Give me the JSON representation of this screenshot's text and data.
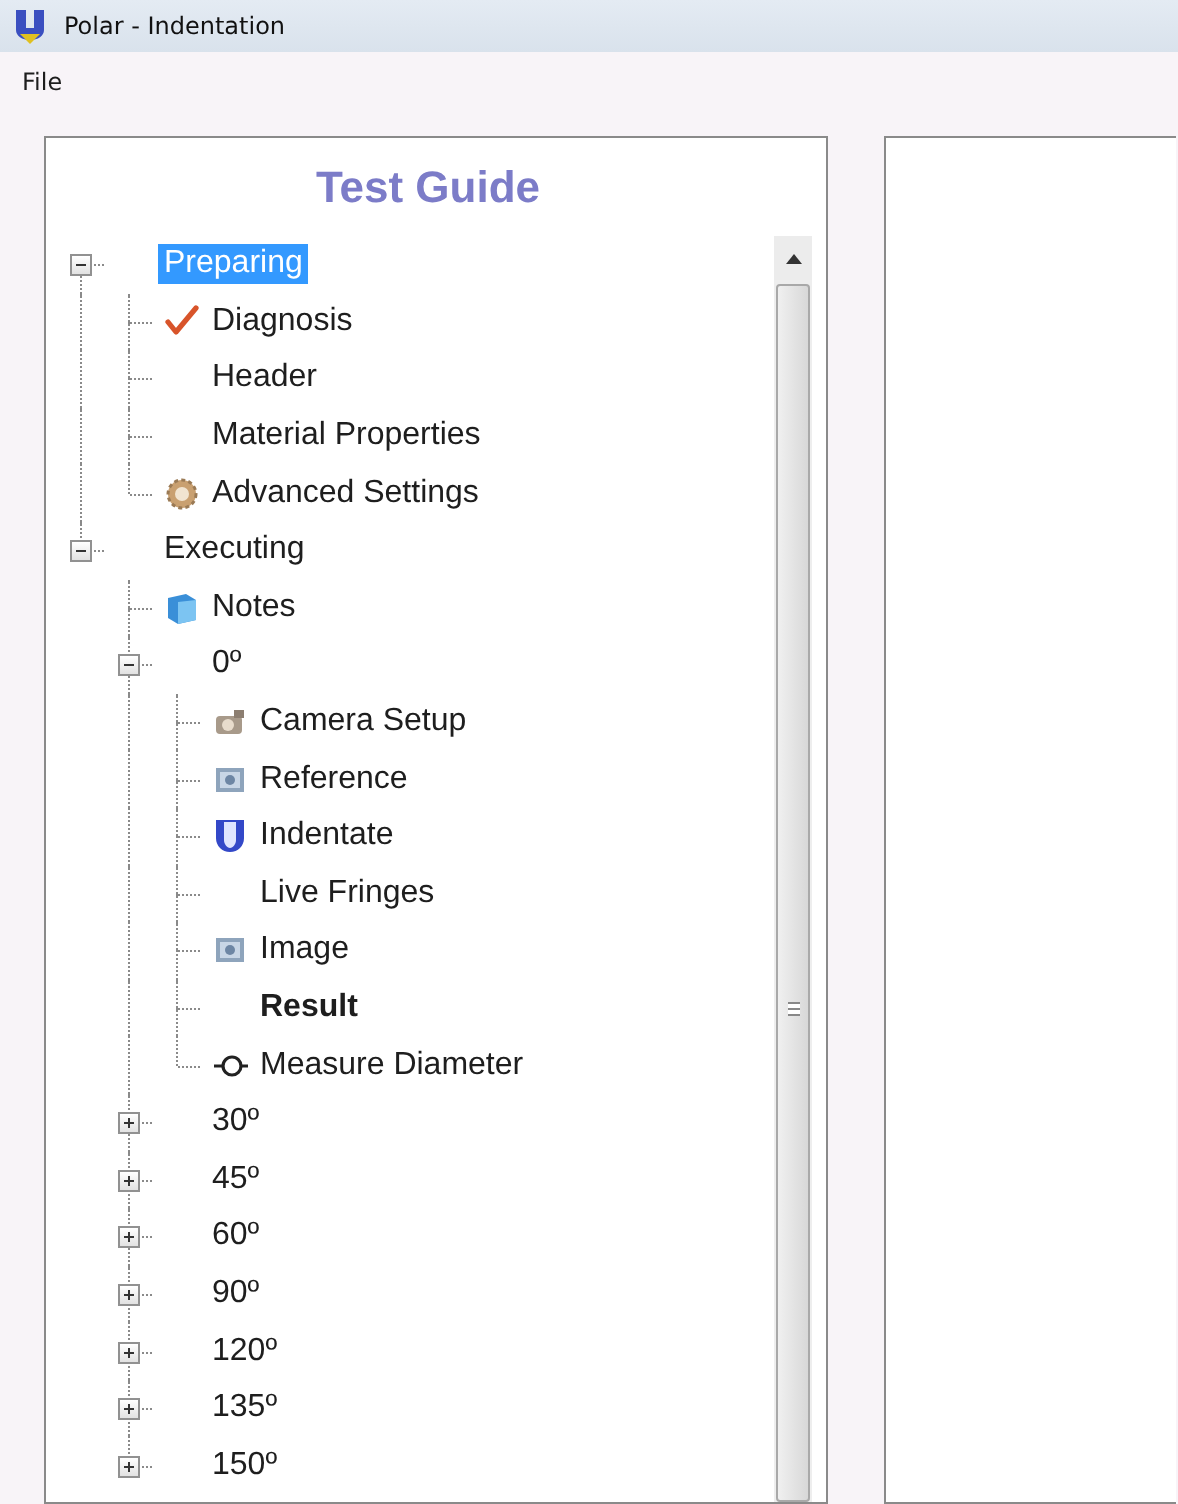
{
  "window": {
    "title": "Polar - Indentation"
  },
  "menu": [
    "File"
  ],
  "guide": {
    "title": "Test Guide",
    "tree": [
      {
        "label": "Preparing",
        "expanded": true,
        "selected": true,
        "bold": false,
        "children": [
          {
            "label": "Diagnosis",
            "kind": "check",
            "selected": false,
            "bold": false
          },
          {
            "label": "Header",
            "selected": false,
            "bold": false
          },
          {
            "label": "Material Properties",
            "selected": false,
            "bold": false
          },
          {
            "label": "Advanced Settings",
            "kind": "gear",
            "selected": false,
            "bold": false
          }
        ]
      },
      {
        "label": "Executing",
        "expanded": true,
        "selected": false,
        "bold": false,
        "children": [
          {
            "label": "Notes",
            "kind": "notes",
            "selected": false,
            "bold": false
          },
          {
            "label": "0º",
            "expanded": true,
            "selected": false,
            "bold": false,
            "children": [
              {
                "label": "Camera Setup",
                "kind": "camera",
                "selected": false,
                "bold": false
              },
              {
                "label": "Reference",
                "kind": "image",
                "selected": false,
                "bold": false
              },
              {
                "label": "Indentate",
                "kind": "indenter",
                "selected": false,
                "bold": false
              },
              {
                "label": "Live Fringes",
                "selected": false,
                "bold": false
              },
              {
                "label": "Image",
                "kind": "image",
                "selected": false,
                "bold": false
              },
              {
                "label": "Result",
                "selected": false,
                "bold": true
              },
              {
                "label": "Measure Diameter",
                "kind": "target",
                "selected": false,
                "bold": false
              }
            ]
          },
          {
            "label": "30º",
            "expanded": false,
            "selected": false,
            "bold": false
          },
          {
            "label": "45º",
            "expanded": false,
            "selected": false,
            "bold": false
          },
          {
            "label": "60º",
            "expanded": false,
            "selected": false,
            "bold": false
          },
          {
            "label": "90º",
            "expanded": false,
            "selected": false,
            "bold": false
          },
          {
            "label": "120º",
            "expanded": false,
            "selected": false,
            "bold": false
          },
          {
            "label": "135º",
            "expanded": false,
            "selected": false,
            "bold": false
          },
          {
            "label": "150º",
            "expanded": false,
            "selected": false,
            "bold": false
          }
        ]
      }
    ]
  }
}
